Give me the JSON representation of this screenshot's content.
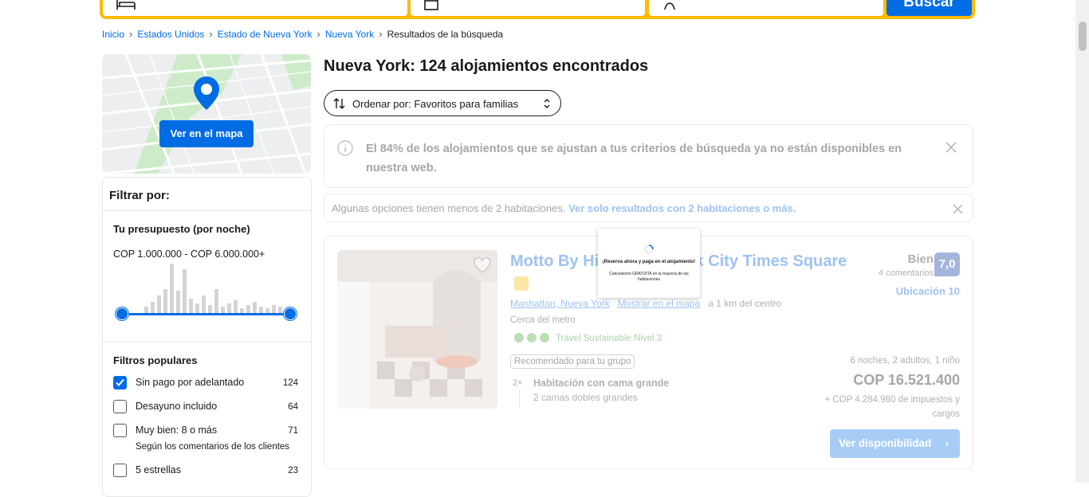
{
  "search": {
    "button_label": "Buscar"
  },
  "breadcrumb": [
    "Inicio",
    "Estados Unidos",
    "Estado de Nueva York",
    "Nueva York"
  ],
  "breadcrumb_current": "Resultados de la búsqueda",
  "map": {
    "button_label": "Ver en el mapa"
  },
  "filters": {
    "title": "Filtrar por:",
    "budget_title": "Tu presupuesto (por noche)",
    "budget_range": "COP 1.000.000 - COP 6.000.000+",
    "popular_title": "Filtros populares",
    "items": [
      {
        "label": "Sin pago por adelantado",
        "count": "124",
        "checked": true
      },
      {
        "label": "Desayuno incluido",
        "count": "64",
        "checked": false
      },
      {
        "label": "Muy bien: 8 o más",
        "count": "71",
        "checked": false,
        "sub": "Según los comentarios de los clientes"
      },
      {
        "label": "5 estrellas",
        "count": "23",
        "checked": false
      }
    ]
  },
  "results": {
    "title": "Nueva York: 124 alojamientos encontrados",
    "sort_label": "Ordenar por: Favoritos para familias"
  },
  "notice": {
    "text": "El 84% de los alojamientos que se ajustan a tus criterios de búsqueda ya no están disponibles en nuestra web."
  },
  "notice2": {
    "text": "Algunas opciones tienen menos de 2 habitaciones.",
    "link": "Ver solo resultados con 2 habitaciones o más."
  },
  "hotel": {
    "name": "Motto By Hilton New York City Times Square",
    "area": "Manhattan, Nueva York",
    "map_link": "Mostrar en el mapa",
    "distance": "a 1 km del centro",
    "metro": "Cerca del metro",
    "sustainable": "Travel Sustainable Nivel 3",
    "recommended": "Recomendado para tu grupo",
    "room_count": "2×",
    "room_name": "Habitación con cama grande",
    "room_beds": "2 camas dobles grandes",
    "rating_word": "Bien",
    "rating_reviews": "4 comentarios",
    "rating_score": "7,0",
    "location_score": "Ubicación 10",
    "stay": "6 noches, 2 adultos, 1 niño",
    "price": "COP 16.521.400",
    "taxes": "+ COP 4.284.980 de impuestos y cargos",
    "availability_button": "Ver disponibilidad"
  },
  "popup": {
    "title": "¡Reserva ahora y paga en el alojamiento!",
    "subtitle": "Cancelación GRATUITA en la mayoría de las habitaciones"
  },
  "colors": {
    "brand": "#006ce4",
    "search_border": "#febb02"
  }
}
